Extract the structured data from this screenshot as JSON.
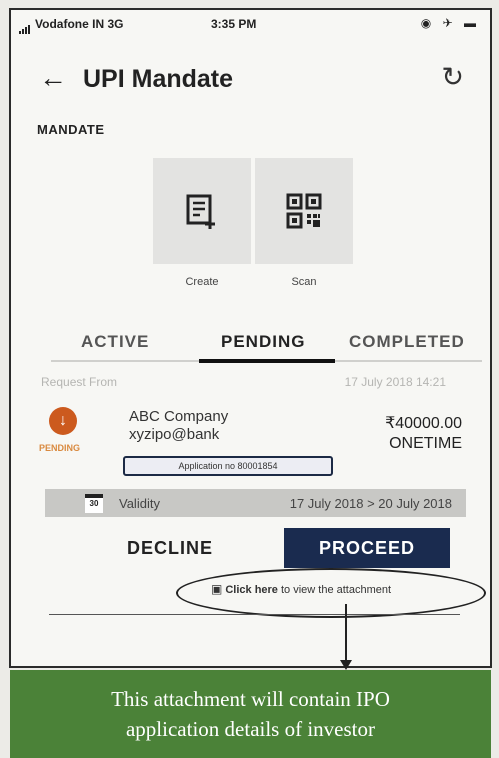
{
  "status_bar": {
    "carrier": "Vodafone IN  3G",
    "time": "3:35 PM",
    "icons": "◉ ✈ ▬"
  },
  "header": {
    "title": "UPI Mandate"
  },
  "section": {
    "label": "MANDATE"
  },
  "tiles": [
    {
      "label": "Create",
      "icon": "create-doc-icon"
    },
    {
      "label": "Scan",
      "icon": "qr-scan-icon"
    }
  ],
  "tabs": [
    {
      "label": "ACTIVE"
    },
    {
      "label": "PENDING",
      "selected": true
    },
    {
      "label": "COMPLETED"
    }
  ],
  "request": {
    "from_label": "Request From",
    "date": "17 July 2018 14:21",
    "status": "PENDING",
    "company": "ABC Company",
    "upi_id": "xyzipo@bank",
    "amount": "₹40000.00",
    "frequency": "ONETIME",
    "application_no": "Application no 80001854"
  },
  "validity": {
    "calendar_day": "30",
    "label": "Validity",
    "range": "17 July 2018 > 20 July 2018"
  },
  "actions": {
    "decline": "DECLINE",
    "proceed": "PROCEED"
  },
  "attachment": {
    "bold_text": "Click here",
    "rest_text": " to view the attachment"
  },
  "callout": {
    "line1": "This attachment will contain IPO",
    "line2": "application details of investor"
  },
  "colors": {
    "proceed_bg": "#1a2b4f",
    "status_orange": "#cc5a1e",
    "callout_green": "#4b8238"
  }
}
